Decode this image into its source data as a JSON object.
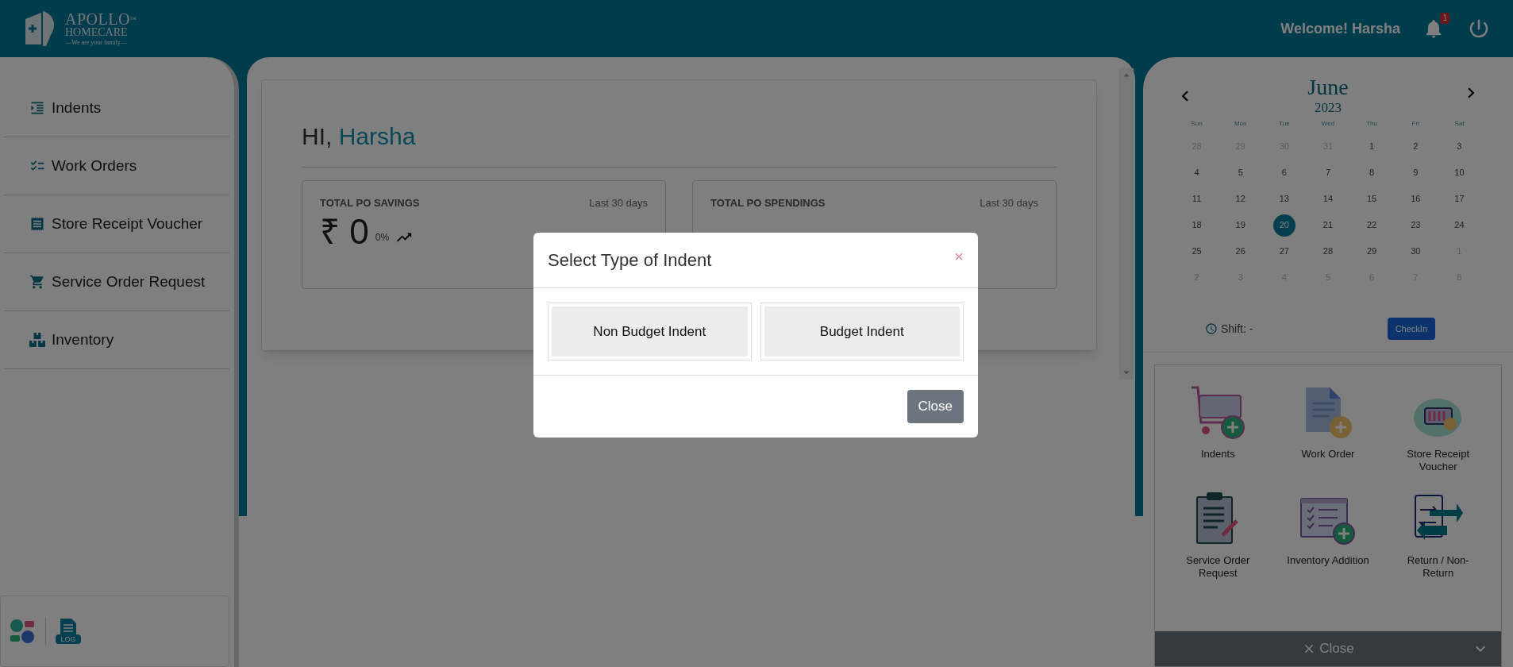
{
  "header": {
    "logo": {
      "name": "APOLLO",
      "trademark": "™",
      "line_2": "HOMECARE",
      "tagline": "—We are your family—"
    },
    "welcome": "Welcome! Harsha",
    "notifications": {
      "count": "1"
    }
  },
  "sidebar": {
    "items": [
      {
        "label": "Indents"
      },
      {
        "label": "Work Orders"
      },
      {
        "label": "Store Receipt Voucher"
      },
      {
        "label": "Service Order Request"
      },
      {
        "label": "Inventory"
      }
    ],
    "footer_icons": [
      {
        "kind": "chat"
      },
      {
        "kind": "log",
        "label": "LOG"
      }
    ]
  },
  "dashboard": {
    "greeting": "HI,",
    "name": "Harsha",
    "cards": [
      {
        "title": "TOTAL PO SAVINGS",
        "period": "Last 30 days",
        "value": "₹ 0",
        "change": "0%"
      },
      {
        "title": "TOTAL PO SPENDINGS",
        "period": "Last 30 days"
      }
    ]
  },
  "modal": {
    "title": "Select Type of Indent",
    "close_symbol": "×",
    "options": [
      "Non Budget Indent",
      "Budget Indent"
    ],
    "footer_button": "Close"
  },
  "calendar": {
    "month": "June",
    "year": "2023",
    "weekdays": [
      "Sun",
      "Mon",
      "Tue",
      "Wed",
      "Thu",
      "Fri",
      "Sat"
    ],
    "days": [
      {
        "label": "28",
        "muted": true,
        "selected": false
      },
      {
        "label": "29",
        "muted": true,
        "selected": false
      },
      {
        "label": "30",
        "muted": true,
        "selected": false
      },
      {
        "label": "31",
        "muted": true,
        "selected": false
      },
      {
        "label": "1",
        "muted": false,
        "selected": false
      },
      {
        "label": "2",
        "muted": false,
        "selected": false
      },
      {
        "label": "3",
        "muted": false,
        "selected": false
      },
      {
        "label": "4",
        "muted": false,
        "selected": false
      },
      {
        "label": "5",
        "muted": false,
        "selected": false
      },
      {
        "label": "6",
        "muted": false,
        "selected": false
      },
      {
        "label": "7",
        "muted": false,
        "selected": false
      },
      {
        "label": "8",
        "muted": false,
        "selected": false
      },
      {
        "label": "9",
        "muted": false,
        "selected": false
      },
      {
        "label": "10",
        "muted": false,
        "selected": false
      },
      {
        "label": "11",
        "muted": false,
        "selected": false
      },
      {
        "label": "12",
        "muted": false,
        "selected": false
      },
      {
        "label": "13",
        "muted": false,
        "selected": false
      },
      {
        "label": "14",
        "muted": false,
        "selected": false
      },
      {
        "label": "15",
        "muted": false,
        "selected": false
      },
      {
        "label": "16",
        "muted": false,
        "selected": false
      },
      {
        "label": "17",
        "muted": false,
        "selected": false
      },
      {
        "label": "18",
        "muted": false,
        "selected": false
      },
      {
        "label": "19",
        "muted": false,
        "selected": false
      },
      {
        "label": "20",
        "muted": false,
        "selected": true
      },
      {
        "label": "21",
        "muted": false,
        "selected": false
      },
      {
        "label": "22",
        "muted": false,
        "selected": false
      },
      {
        "label": "23",
        "muted": false,
        "selected": false
      },
      {
        "label": "24",
        "muted": false,
        "selected": false
      },
      {
        "label": "25",
        "muted": false,
        "selected": false
      },
      {
        "label": "26",
        "muted": false,
        "selected": false
      },
      {
        "label": "27",
        "muted": false,
        "selected": false
      },
      {
        "label": "28",
        "muted": false,
        "selected": false
      },
      {
        "label": "29",
        "muted": false,
        "selected": false
      },
      {
        "label": "30",
        "muted": false,
        "selected": false
      },
      {
        "label": "1",
        "muted": true,
        "selected": false
      },
      {
        "label": "2",
        "muted": true,
        "selected": false
      },
      {
        "label": "3",
        "muted": true,
        "selected": false
      },
      {
        "label": "4",
        "muted": true,
        "selected": false
      },
      {
        "label": "5",
        "muted": true,
        "selected": false
      },
      {
        "label": "6",
        "muted": true,
        "selected": false
      },
      {
        "label": "7",
        "muted": true,
        "selected": false
      },
      {
        "label": "8",
        "muted": true,
        "selected": false
      }
    ],
    "shift": "Shift: -",
    "checkin_button": "CheckIn"
  },
  "quick_actions": {
    "tiles": [
      {
        "kind": "cart",
        "label": "Indents"
      },
      {
        "kind": "document",
        "label": "Work Order"
      },
      {
        "kind": "basket",
        "label": "Store Receipt Voucher"
      },
      {
        "kind": "clipboard",
        "label": "Service Order Request"
      },
      {
        "kind": "checklist",
        "label": "Inventory Addition"
      },
      {
        "kind": "exchange",
        "label": "Return / Non-Return"
      }
    ],
    "close_bar": "Close"
  }
}
